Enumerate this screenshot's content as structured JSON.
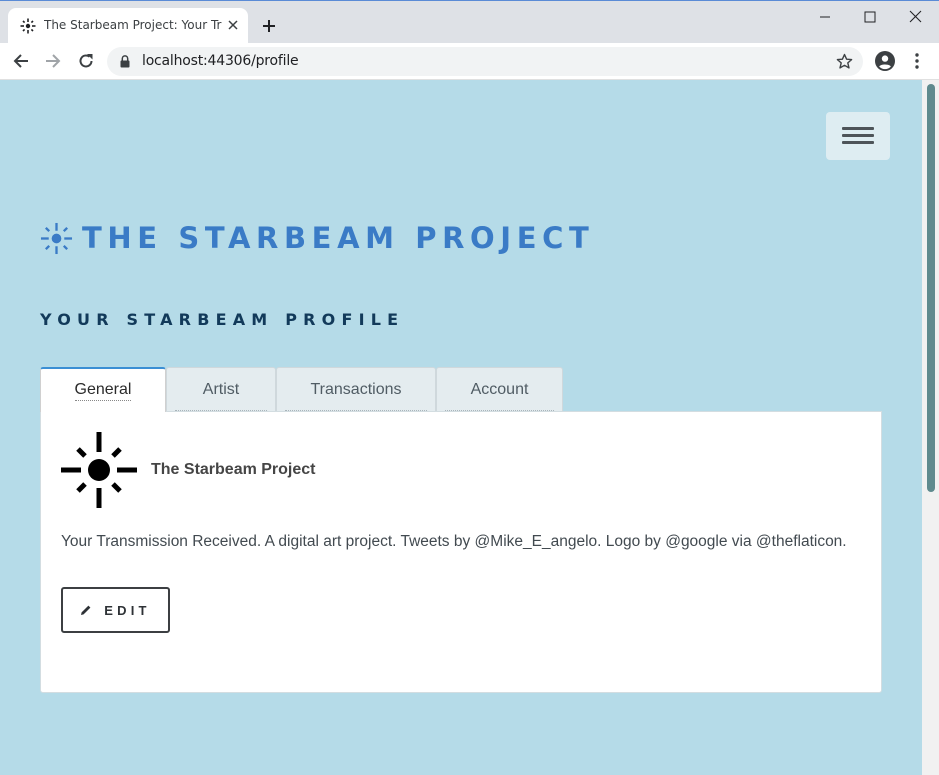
{
  "browser": {
    "tab_title": "The Starbeam Project: Your Transmission Received",
    "url": "localhost:44306/profile"
  },
  "page": {
    "brand_title": "THE STARBEAM PROJECT",
    "subtitle": "YOUR STARBEAM PROFILE",
    "tabs": [
      {
        "label": "General",
        "active": true
      },
      {
        "label": "Artist",
        "active": false
      },
      {
        "label": "Transactions",
        "active": false
      },
      {
        "label": "Account",
        "active": false
      }
    ],
    "profile": {
      "name": "The Starbeam Project",
      "description": "Your Transmission Received. A digital art project. Tweets by @Mike_E_angelo. Logo by @google via @theflaticon."
    },
    "edit_label": "EDIT"
  },
  "colors": {
    "page_background": "#b5dbe8",
    "brand_blue": "#3a7bc6",
    "subtitle_navy": "#123a5a",
    "active_tab_accent": "#3b8fd4"
  },
  "icons": {
    "tab_favicon": "starburst-icon",
    "brand_logo": "starburst-icon",
    "avatar": "starburst-icon",
    "edit": "pencil-icon",
    "menu": "hamburger-icon"
  }
}
